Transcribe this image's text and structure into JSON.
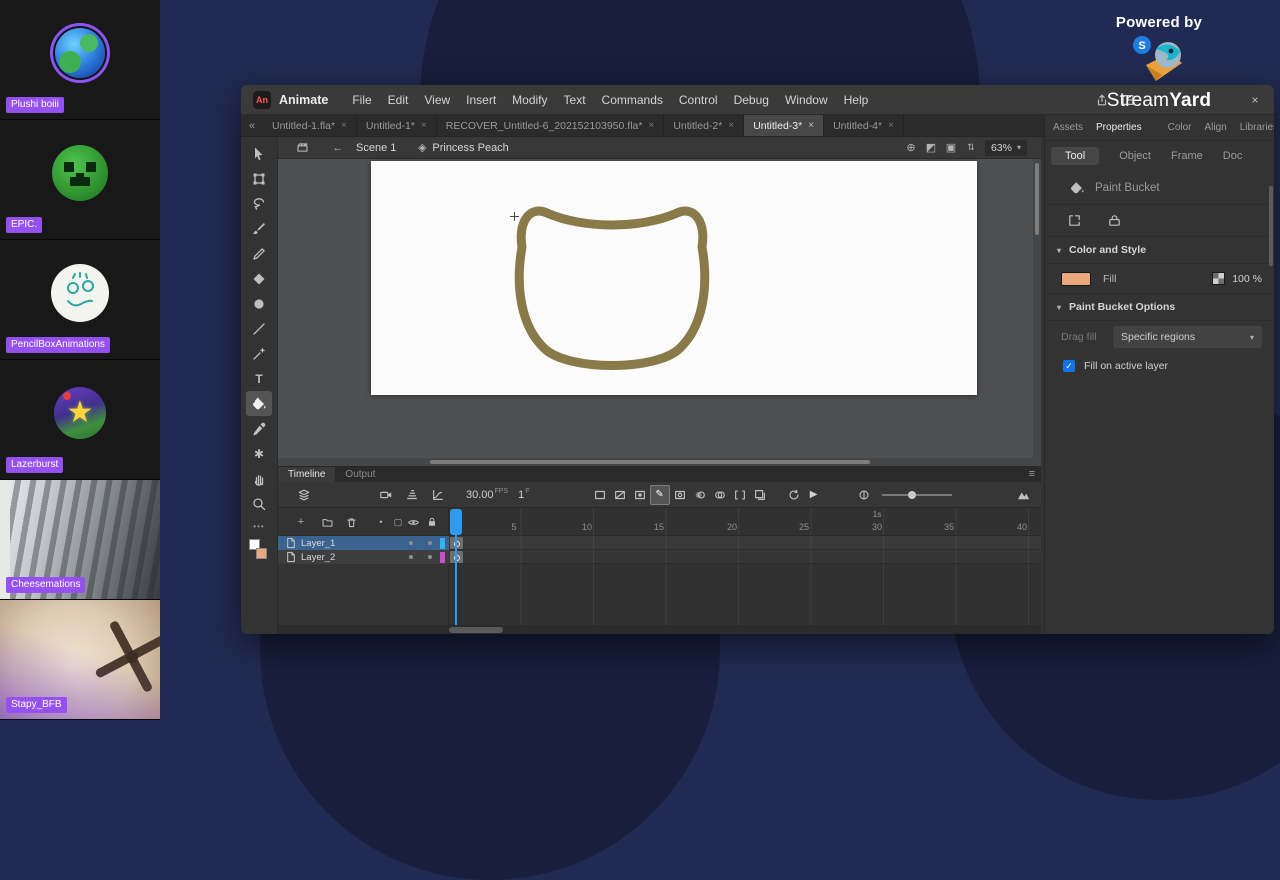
{
  "icons": {
    "close": "×",
    "chevron": "▾",
    "hamburger": "≡",
    "collapse": "«",
    "back": "←",
    "target": "⊕",
    "symbol": "◈",
    "clip": "▣",
    "snap": "◩",
    "stepper": "⇅",
    "dot": "•",
    "outline_box": "▢",
    "play": "▶",
    "pencil_edit": "✎",
    "star": "★",
    "asterisk": "✱",
    "text_tool": "T",
    "ellipsis": "•••",
    "plus": "+",
    "check": "✓",
    "logo_mark": "An",
    "s_badge": "S"
  },
  "overlay": {
    "powered_by": "Powered by",
    "brand_stream": "Stream",
    "brand_yard": "Yard",
    "badge_color": "#9550f0",
    "participants": [
      {
        "name": "Plushi boiii"
      },
      {
        "name": "EPIC."
      },
      {
        "name": "PencilBoxAnimations"
      },
      {
        "name": "Lazerburst"
      },
      {
        "name": "Cheesemations"
      },
      {
        "name": "Stapy_BFB"
      }
    ]
  },
  "app": {
    "name": "Animate",
    "menus": [
      "File",
      "Edit",
      "View",
      "Insert",
      "Modify",
      "Text",
      "Commands",
      "Control",
      "Debug",
      "Window",
      "Help"
    ],
    "tabs": [
      {
        "label": "Untitled-1.fla*"
      },
      {
        "label": "Untitled-1*"
      },
      {
        "label": "RECOVER_Untitled-6_202152103950.fla*"
      },
      {
        "label": "Untitled-2*"
      },
      {
        "label": "Untitled-3*"
      },
      {
        "label": "Untitled-4*"
      }
    ],
    "editbar": {
      "scene": "Scene 1",
      "symbol": "Princess Peach",
      "zoom": "63%"
    },
    "stage_stroke_color": "#8b7a49"
  },
  "timeline": {
    "tabs": [
      "Timeline",
      "Output"
    ],
    "fps_value": "30.00",
    "fps_label": "FPS",
    "frame_value": "1",
    "frame_label": "F",
    "layers": [
      {
        "name": "Layer_1",
        "color": "#31b4f2"
      },
      {
        "name": "Layer_2",
        "color": "#c94fd0"
      }
    ],
    "ruler": [
      "5",
      "10",
      "15",
      "20",
      "25",
      "30",
      "35",
      "40"
    ],
    "seconds": "1s",
    "playhead_color": "#2f9bf0"
  },
  "properties": {
    "panel_tabs": [
      "Assets",
      "Properties"
    ],
    "dock_tabs": [
      "Color",
      "Align",
      "Libraries"
    ],
    "subtabs": [
      "Tool",
      "Object",
      "Frame",
      "Doc"
    ],
    "tool_name": "Paint Bucket",
    "color_style": {
      "title": "Color and Style",
      "fill_label": "Fill",
      "fill_color": "#eaa87c",
      "fill_alpha": "100 %"
    },
    "options": {
      "title": "Paint Bucket Options",
      "drag_label": "Drag fill",
      "drag_value": "Specific regions",
      "checkbox_label": "Fill on active layer"
    },
    "accent": "#1473e6"
  }
}
